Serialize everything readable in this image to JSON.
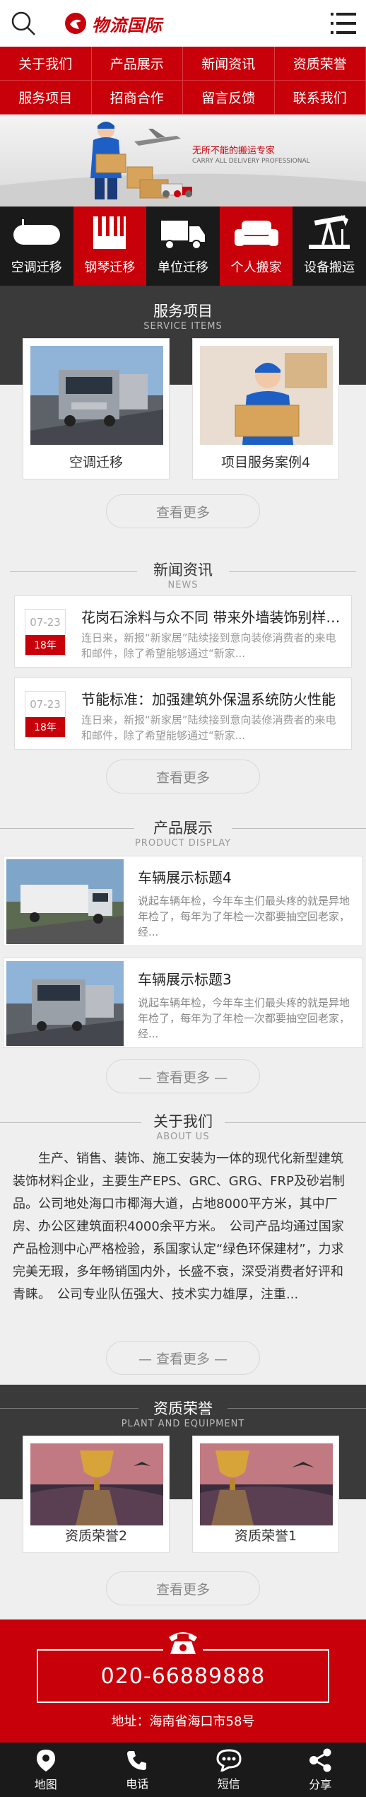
{
  "header": {
    "logo_text": "物流国际"
  },
  "nav": [
    "关于我们",
    "产品展示",
    "新闻资讯",
    "资质荣誉",
    "服务项目",
    "招商合作",
    "留言反馈",
    "联系我们"
  ],
  "banner": {
    "slogan": "无所不能的搬运专家",
    "sub": "CARRY ALL DELIVERY PROFESSIONAL"
  },
  "services": [
    {
      "label": "空调迁移",
      "icon": "air-conditioner-icon",
      "active": false
    },
    {
      "label": "钢琴迁移",
      "icon": "piano-icon",
      "active": true
    },
    {
      "label": "单位迁移",
      "icon": "truck-icon",
      "active": false
    },
    {
      "label": "个人搬家",
      "icon": "sofa-icon",
      "active": true
    },
    {
      "label": "设备搬运",
      "icon": "oil-pump-icon",
      "active": false
    }
  ],
  "service_items": {
    "title": "服务项目",
    "subtitle": "SERVICE ITEMS",
    "cards": [
      "空调迁移",
      "项目服务案例4"
    ],
    "more": "查看更多"
  },
  "news": {
    "title": "新闻资讯",
    "subtitle": "NEWS",
    "items": [
      {
        "date": "07-23",
        "year": "18年",
        "title": "花岗石涂料与众不同 带来外墙装饰别样风情",
        "summary": "连日来，新报“新家居”陆续接到意向装修消费者的来电和邮件，除了希望能够通过“新家..."
      },
      {
        "date": "07-23",
        "year": "18年",
        "title": "节能标准：加强建筑外保温系统防火性能",
        "summary": "连日来，新报“新家居”陆续接到意向装修消费者的来电和邮件，除了希望能够通过“新家..."
      }
    ],
    "more": "查看更多"
  },
  "products": {
    "title": "产品展示",
    "subtitle": "PRODUCT DISPLAY",
    "items": [
      {
        "title": "车辆展示标题4",
        "summary": "说起车辆年检，今年车主们最头疼的就是异地年检了，每年为了年检一次都要抽空回老家，经..."
      },
      {
        "title": "车辆展示标题3",
        "summary": "说起车辆年检，今年车主们最头疼的就是异地年检了，每年为了年检一次都要抽空回老家，经..."
      }
    ],
    "more": "— 查看更多 —"
  },
  "about": {
    "title": "关于我们",
    "subtitle": "ABOUT US",
    "text": "生产、销售、装饰、施工安装为一体的现代化新型建筑装饰材料企业，主要生产EPS、GRC、GRG、FRP及砂岩制品。公司地处海口市椰海大道，占地8000平方米，其中厂房、办公区建筑面积4000余平方米。　公司产品均通过国家产品检测中心严格检验，系国家认定“绿色环保建材”，力求完美无瑕，多年畅销国内外，长盛不衰，深受消费者好评和青睐。　公司专业队伍强大、技术实力雄厚，注重...",
    "more": "— 查看更多 —"
  },
  "honor": {
    "title": "资质荣誉",
    "subtitle": "PLANT AND EQUIPMENT",
    "cards": [
      "资质荣誉2",
      "资质荣誉1"
    ],
    "more": "查看更多"
  },
  "contact": {
    "phone": "020-66889888",
    "address": "地址：海南省海口市58号"
  },
  "bottom": [
    {
      "label": "地图",
      "icon": "map-pin-icon"
    },
    {
      "label": "电话",
      "icon": "phone-icon"
    },
    {
      "label": "短信",
      "icon": "message-icon"
    },
    {
      "label": "分享",
      "icon": "share-icon"
    }
  ]
}
